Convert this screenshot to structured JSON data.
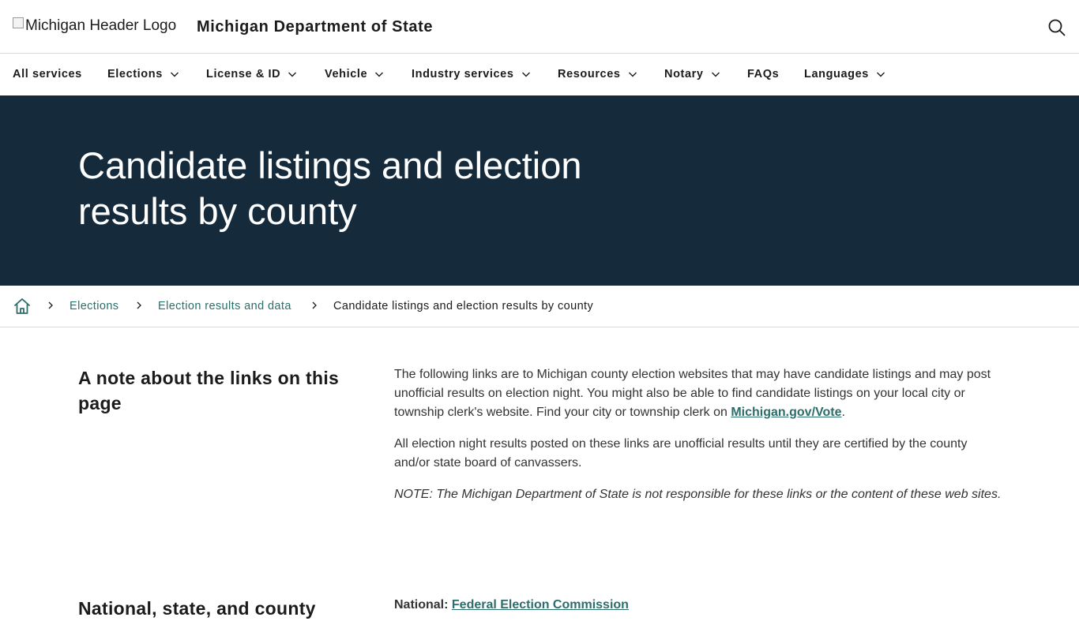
{
  "header": {
    "logo_alt": "Michigan Header Logo",
    "site_title": "Michigan Department of State"
  },
  "nav": {
    "items": [
      {
        "label": "All services",
        "dropdown": false
      },
      {
        "label": "Elections",
        "dropdown": true
      },
      {
        "label": "License & ID",
        "dropdown": true
      },
      {
        "label": "Vehicle",
        "dropdown": true
      },
      {
        "label": "Industry services",
        "dropdown": true
      },
      {
        "label": "Resources",
        "dropdown": true
      },
      {
        "label": "Notary",
        "dropdown": true
      },
      {
        "label": "FAQs",
        "dropdown": false
      },
      {
        "label": "Languages",
        "dropdown": true
      }
    ]
  },
  "hero": {
    "title": "Candidate listings and election results by county"
  },
  "breadcrumb": {
    "items": [
      "Elections",
      "Election results and data"
    ],
    "current": "Candidate listings and election results by county"
  },
  "section1": {
    "heading": "A note about the links on this page",
    "p1_text": "The following links are to Michigan county election websites that may have candidate listings and may post unofficial results on election night. You might also be able to find candidate listings on your local city or township clerk's website. Find your city or township clerk on ",
    "p1_link": "Michigan.gov/Vote",
    "p1_end": ".",
    "p2": "All election night results posted on these links are unofficial results until they are certified by the county and/or state board of canvassers.",
    "note": "NOTE: The Michigan Department of State is not responsible for these links or the content of these web sites."
  },
  "section2": {
    "heading": "National, state, and county",
    "label": "National: ",
    "link": "Federal Election Commission"
  },
  "colors": {
    "hero_bg": "#152a3b",
    "link": "#2b6e6a",
    "text": "#1b1b1b"
  }
}
